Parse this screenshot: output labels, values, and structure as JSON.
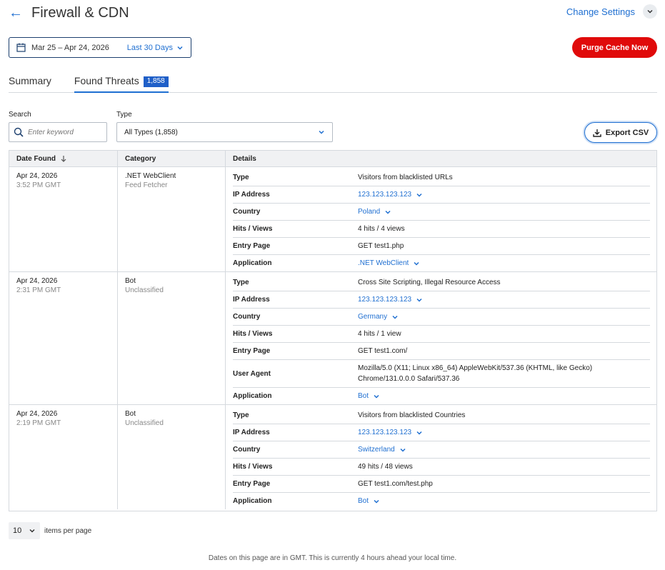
{
  "header": {
    "title": "Firewall & CDN",
    "back_icon": "arrow-left-icon",
    "change_settings_label": "Change Settings"
  },
  "filters": {
    "date_range": "Mar 25 – Apr 24, 2026",
    "date_preset": "Last 30 Days",
    "purge_label": "Purge Cache Now",
    "search_label": "Search",
    "search_placeholder": "Enter keyword",
    "type_label": "Type",
    "type_value": "All Types (1,858)",
    "export_label": "Export CSV"
  },
  "tabs": [
    {
      "label": "Summary",
      "active": false
    },
    {
      "label": "Found Threats",
      "active": true,
      "badge": "1,858"
    }
  ],
  "table": {
    "columns": [
      "Date Found",
      "Category",
      "Details"
    ],
    "rows": [
      {
        "date": "Apr 24, 2026",
        "time": "3:52 PM GMT",
        "category": ".NET WebClient",
        "subcategory": "Feed Fetcher",
        "details": [
          {
            "key": "Type",
            "value": "Visitors from blacklisted URLs",
            "link": false
          },
          {
            "key": "IP Address",
            "value": "123.123.123.123",
            "link": true
          },
          {
            "key": "Country",
            "value": "Poland",
            "link": true
          },
          {
            "key": "Hits / Views",
            "value": "4 hits / 4 views",
            "link": false
          },
          {
            "key": "Entry Page",
            "value": "GET test1.php",
            "link": false
          },
          {
            "key": "Application",
            "value": ".NET WebClient",
            "link": true
          }
        ]
      },
      {
        "date": "Apr 24, 2026",
        "time": "2:31 PM GMT",
        "category": "Bot",
        "subcategory": "Unclassified",
        "details": [
          {
            "key": "Type",
            "value": "Cross Site Scripting, Illegal Resource Access",
            "link": false
          },
          {
            "key": "IP Address",
            "value": "123.123.123.123",
            "link": true
          },
          {
            "key": "Country",
            "value": "Germany",
            "link": true
          },
          {
            "key": "Hits / Views",
            "value": "4 hits / 1 view",
            "link": false
          },
          {
            "key": "Entry Page",
            "value": "GET test1.com/",
            "link": false
          },
          {
            "key": "User Agent",
            "value": "Mozilla/5.0 (X11; Linux x86_64) AppleWebKit/537.36 (KHTML, like Gecko) Chrome/131.0.0.0 Safari/537.36",
            "link": false
          },
          {
            "key": "Application",
            "value": "Bot",
            "link": true
          }
        ]
      },
      {
        "date": "Apr 24, 2026",
        "time": "2:19 PM GMT",
        "category": "Bot",
        "subcategory": "Unclassified",
        "details": [
          {
            "key": "Type",
            "value": "Visitors from blacklisted Countries",
            "link": false
          },
          {
            "key": "IP Address",
            "value": "123.123.123.123",
            "link": true
          },
          {
            "key": "Country",
            "value": "Switzerland",
            "link": true
          },
          {
            "key": "Hits / Views",
            "value": "49 hits / 48 views",
            "link": false
          },
          {
            "key": "Entry Page",
            "value": "GET test1.com/test.php",
            "link": false
          },
          {
            "key": "Application",
            "value": "Bot",
            "link": true
          }
        ]
      }
    ]
  },
  "pagination": {
    "per_page": "10",
    "per_page_label": "items per page"
  },
  "footer_note": "Dates on this page are in GMT. This is currently 4 hours ahead your local time.",
  "colors": {
    "accent": "#1f6fd1",
    "danger": "#e00a0a",
    "badge": "#1f5fc8"
  }
}
